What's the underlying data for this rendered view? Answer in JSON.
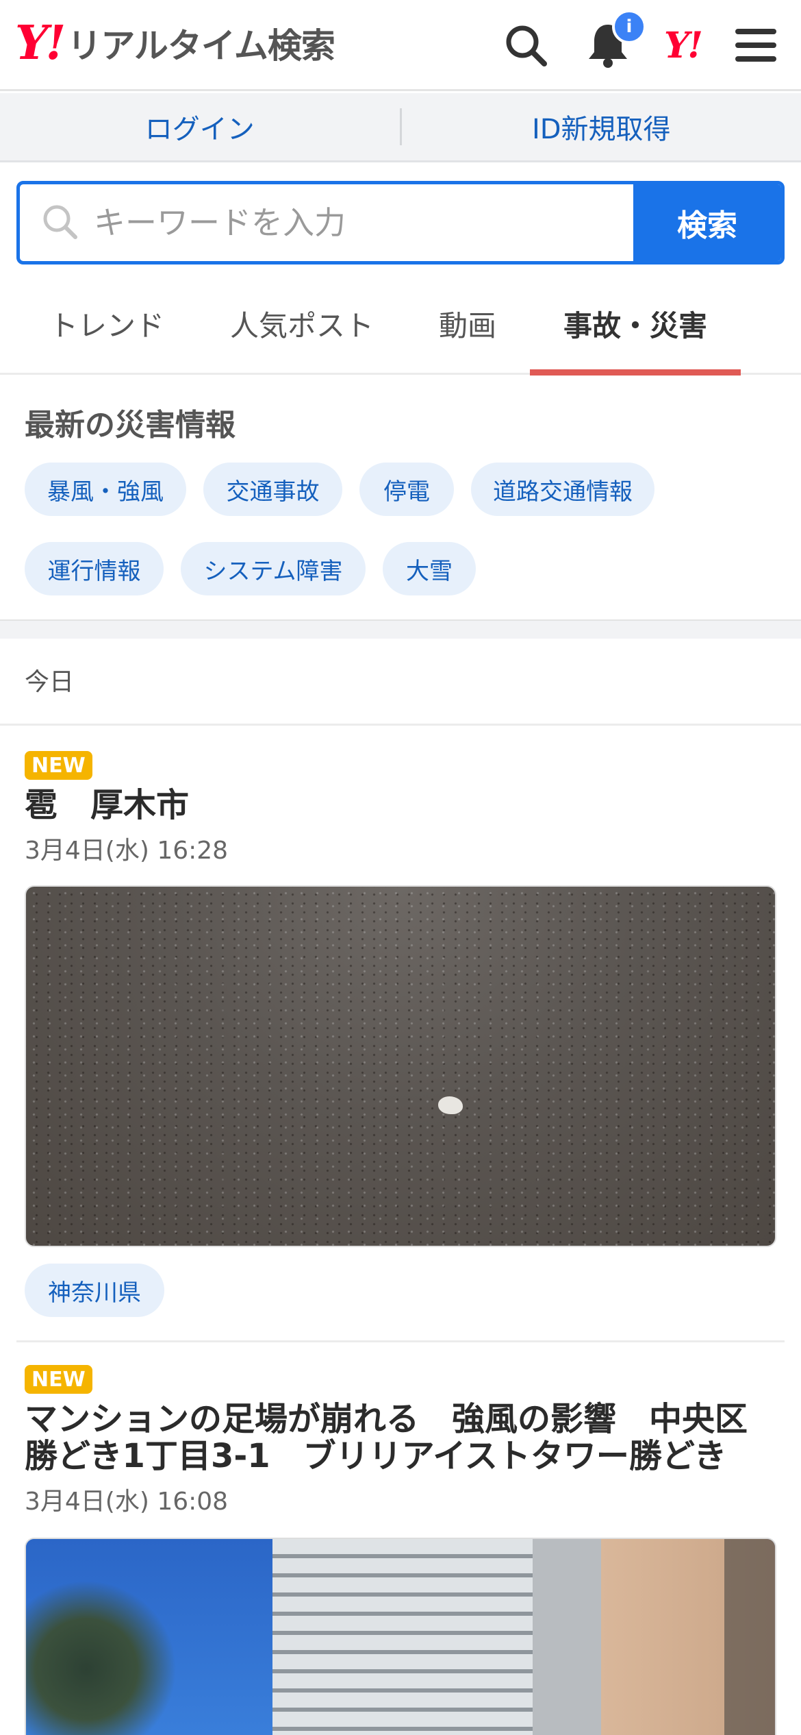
{
  "header": {
    "logo_mark": "Y!",
    "logo_text": "リアルタイム検索",
    "notification_badge": "i",
    "yahoo_mark": "Y!",
    "icons": [
      "search-icon",
      "bell-icon",
      "yahoo-icon",
      "menu-icon"
    ]
  },
  "auth": {
    "login": "ログイン",
    "register": "ID新規取得"
  },
  "search": {
    "placeholder": "キーワードを入力",
    "button": "検索"
  },
  "tabs": [
    {
      "label": "トレンド",
      "active": false
    },
    {
      "label": "人気ポスト",
      "active": false
    },
    {
      "label": "動画",
      "active": false
    },
    {
      "label": "事故・災害",
      "active": true
    }
  ],
  "disaster": {
    "title": "最新の災害情報",
    "chips": [
      "暴風・強風",
      "交通事故",
      "停電",
      "道路交通情報",
      "運行情報",
      "システム障害",
      "大雪"
    ]
  },
  "feed": {
    "section_label": "今日",
    "items": [
      {
        "badge": "NEW",
        "title": "雹　厚木市",
        "date": "3月4日(水) 16:28",
        "tag": "神奈川県"
      },
      {
        "badge": "NEW",
        "title_line1": "マンションの足場が崩れる　強風の影響　中央区",
        "title_line2": "勝どき1丁目3-1　ブリリアイストタワー勝どき",
        "date": "3月4日(水) 16:08"
      }
    ]
  },
  "colors": {
    "brand_red": "#ff0033",
    "accent_blue": "#1a73e8",
    "link_blue": "#1560bd",
    "chip_bg": "#e7f0fb",
    "new_badge": "#f5b400",
    "active_tab_underline": "#e05a55"
  }
}
